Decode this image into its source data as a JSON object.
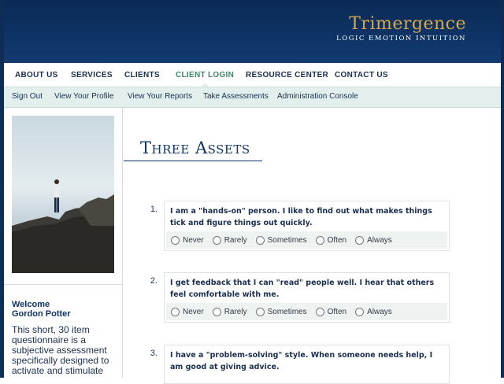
{
  "brand": {
    "name": "Trimergence",
    "tagline": "LOGIC EMOTION INTUITION"
  },
  "main_nav": [
    {
      "label": "ABOUT US"
    },
    {
      "label": "SERVICES"
    },
    {
      "label": "CLIENTS"
    },
    {
      "label": "CLIENT LOGIN",
      "active": true
    },
    {
      "label": "RESOURCE CENTER"
    },
    {
      "label": "CONTACT US"
    }
  ],
  "sub_nav": [
    {
      "label": "Sign Out"
    },
    {
      "label": "View Your Profile"
    },
    {
      "label": "View Your Reports"
    },
    {
      "label": "Take Assessments"
    },
    {
      "label": "Administration Console"
    }
  ],
  "sidebar": {
    "welcome_line1": "Welcome",
    "welcome_line2": "Gordon Potter",
    "intro": "This short, 30 item questionnaire is a subjective assessment specifically designed to activate and stimulate"
  },
  "page": {
    "title": "Three Assets"
  },
  "options": [
    "Never",
    "Rarely",
    "Sometimes",
    "Often",
    "Always"
  ],
  "questions": [
    {
      "number": "1.",
      "text": "I am a \"hands-on\" person. I like to find out what makes things tick and figure things out quickly."
    },
    {
      "number": "2.",
      "text": "I get feedback that I can \"read\" people well. I hear that others feel comfortable with me."
    },
    {
      "number": "3.",
      "text": "I have a \"problem-solving\" style. When someone needs help, I am good at giving advice."
    }
  ],
  "colors": {
    "navy": "#0e3466",
    "gold": "#d7a94a",
    "active_green": "#3f8a66",
    "subnav_bg": "#e2efec"
  }
}
